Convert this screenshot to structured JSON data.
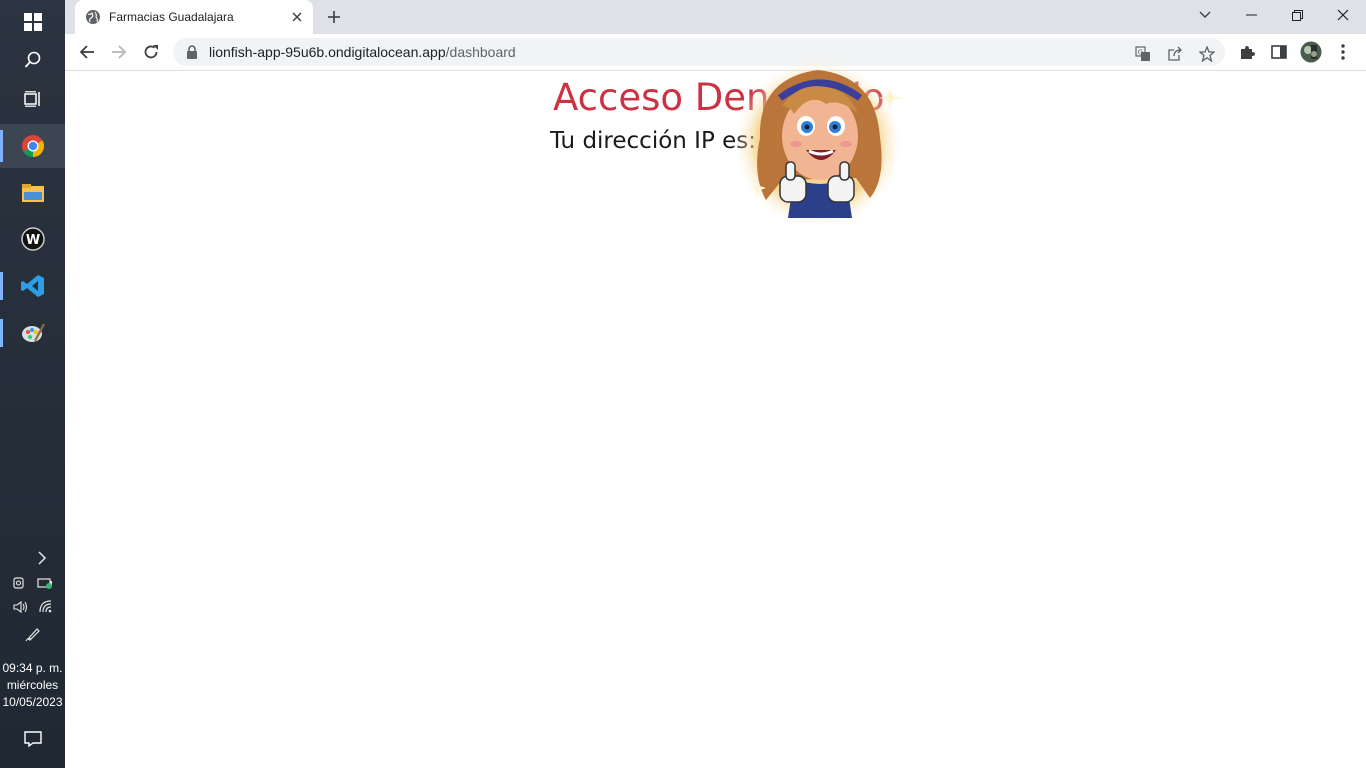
{
  "taskbar": {
    "apps": [
      {
        "name": "start",
        "icon": "windows-icon"
      },
      {
        "name": "search",
        "icon": "search-icon"
      },
      {
        "name": "task-view",
        "icon": "task-view-icon"
      },
      {
        "name": "chrome",
        "icon": "chrome-icon"
      },
      {
        "name": "file-explorer",
        "icon": "folder-icon"
      },
      {
        "name": "app-w",
        "icon": "w-app-icon"
      },
      {
        "name": "vscode",
        "icon": "vscode-icon"
      },
      {
        "name": "paint",
        "icon": "paint-icon"
      }
    ],
    "clock": {
      "time": "09:34 p. m.",
      "day": "miércoles",
      "date": "10/05/2023"
    }
  },
  "browser": {
    "tab_title": "Farmacias Guadalajara",
    "url_host": "lionfish-app-95u6b.ondigitalocean.app",
    "url_path": "/dashboard"
  },
  "page": {
    "heading": "Acceso Denegado",
    "ip_label": "Tu dirección IP es:"
  },
  "colors": {
    "heading": "#cc3342",
    "taskbar": "#2b3440",
    "tabbar": "#dee1e6"
  }
}
